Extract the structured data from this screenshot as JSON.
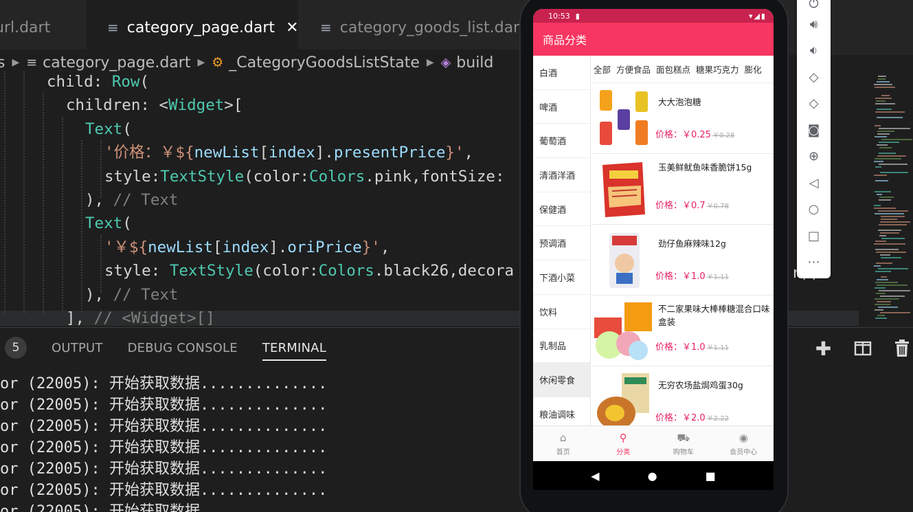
{
  "tabs": [
    {
      "label": "url.dart"
    },
    {
      "label": "category_page.dart",
      "close": "✕"
    },
    {
      "label": "category_goods_list.dart"
    }
  ],
  "breadcrumb": {
    "lead": "s",
    "file": "category_page.dart",
    "class": "_CategoryGoodsListState",
    "method": "build"
  },
  "code": [
    {
      "tokens": [
        [
          "t-prop",
          "child: "
        ],
        [
          "t-cls",
          "Row"
        ],
        [
          "t-prop",
          "("
        ]
      ]
    },
    {
      "tokens": [
        [
          "t-prop",
          "children: <"
        ],
        [
          "t-cls",
          "Widget"
        ],
        [
          "t-prop",
          ">["
        ]
      ]
    },
    {
      "tokens": [
        [
          "t-cls",
          "Text"
        ],
        [
          "t-prop",
          "("
        ]
      ]
    },
    {
      "tokens": [
        [
          "t-str",
          "'价格：￥${"
        ],
        [
          "t-var",
          "newList"
        ],
        [
          "t-prop",
          "["
        ],
        [
          "t-var",
          "index"
        ],
        [
          "t-prop",
          "]."
        ],
        [
          "t-var",
          "presentPrice"
        ],
        [
          "t-str",
          "}'"
        ],
        [
          "t-prop",
          ","
        ]
      ]
    },
    {
      "tokens": [
        [
          "t-prop",
          "style:"
        ],
        [
          "t-cls",
          "TextStyle"
        ],
        [
          "t-prop",
          "(color:"
        ],
        [
          "t-cls",
          "Colors"
        ],
        [
          "t-prop",
          ".pink,fontSize:"
        ]
      ]
    },
    {
      "tokens": [
        [
          "t-prop",
          "), "
        ],
        [
          "t-com2",
          "// Text"
        ]
      ]
    },
    {
      "tokens": [
        [
          "t-cls",
          "Text"
        ],
        [
          "t-prop",
          "("
        ]
      ]
    },
    {
      "tokens": [
        [
          "t-str",
          "'￥${"
        ],
        [
          "t-var",
          "newList"
        ],
        [
          "t-prop",
          "["
        ],
        [
          "t-var",
          "index"
        ],
        [
          "t-prop",
          "]."
        ],
        [
          "t-var",
          "oriPrice"
        ],
        [
          "t-str",
          "}'"
        ],
        [
          "t-prop",
          ","
        ]
      ]
    },
    {
      "tokens": [
        [
          "t-prop",
          "style: "
        ],
        [
          "t-cls",
          "TextStyle"
        ],
        [
          "t-prop",
          "(color:"
        ],
        [
          "t-cls",
          "Colors"
        ],
        [
          "t-prop",
          ".black26,decora"
        ]
      ]
    },
    {
      "tokens": [
        [
          "t-prop",
          "), "
        ],
        [
          "t-com2",
          "// Text"
        ]
      ]
    },
    {
      "tokens": [
        [
          "t-prop",
          "], "
        ],
        [
          "t-com2",
          "// <Widget>[]"
        ]
      ]
    }
  ],
  "code_tail": "r),",
  "panel": {
    "badge": "5",
    "tabs": [
      "OUTPUT",
      "DEBUG CONSOLE",
      "TERMINAL"
    ],
    "terminal_lines": [
      "or (22005): 开始获取数据..............",
      "or (22005): 开始获取数据..............",
      "or (22005): 开始获取数据..............",
      "or (22005): 开始获取数据..............",
      "or (22005): 开始获取数据..............",
      "or (22005): 开始获取数据..............",
      "or (22005): 开始获取数据"
    ]
  },
  "phone": {
    "time": "10:53",
    "title": "商品分类",
    "categories": [
      "白酒",
      "啤酒",
      "葡萄酒",
      "清酒洋酒",
      "保健酒",
      "预调酒",
      "下酒小菜",
      "饮料",
      "乳制品",
      "休闲零食",
      "粮油调味"
    ],
    "selected_category": "休闲零食",
    "subcategories": [
      "全部",
      "方便食品",
      "面包糕点",
      "糖果巧克力",
      "膨化"
    ],
    "goods": [
      {
        "name": "大大泡泡糖",
        "price": "价格：￥0.25",
        "old": "￥0.28"
      },
      {
        "name": "玉美鲜鱿鱼味香脆饼15g",
        "price": "价格：￥0.7",
        "old": "￥0.78"
      },
      {
        "name": "劲仔鱼麻辣味12g",
        "price": "价格：￥1.0",
        "old": "￥1.11"
      },
      {
        "name": "不二家果味大棒棒糖混合口味盒装",
        "price": "价格：￥1.0",
        "old": "￥1.11"
      },
      {
        "name": "无穷农场盐焗鸡蛋30g",
        "price": "价格：￥2.0",
        "old": "￥2.22"
      }
    ],
    "bottom_nav": [
      {
        "label": "首页",
        "icon": "home-icon"
      },
      {
        "label": "分类",
        "icon": "search-icon"
      },
      {
        "label": "购物车",
        "icon": "cart-icon"
      },
      {
        "label": "会员中心",
        "icon": "user-icon"
      }
    ],
    "active_tab": "分类"
  },
  "colors": {
    "appbar": "#f73661",
    "statusbar": "#c8224f",
    "price": "#e91e63",
    "editor_bg": "#1e1e1e"
  }
}
